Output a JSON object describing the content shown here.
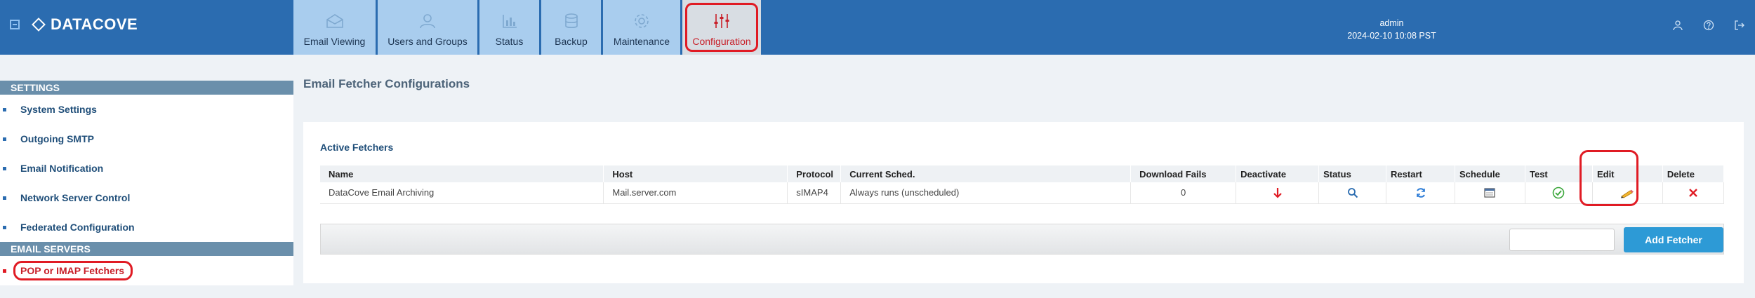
{
  "header": {
    "brand": "DATACOVE",
    "user": "admin",
    "datetime": "2024-02-10 10:08 PST",
    "accent": "#2b6cb0"
  },
  "nav": {
    "tabs": [
      {
        "label": "Email Viewing",
        "icon": "envelope-icon"
      },
      {
        "label": "Users and Groups",
        "icon": "users-icon"
      },
      {
        "label": "Status",
        "icon": "bar-chart-icon"
      },
      {
        "label": "Backup",
        "icon": "database-icon"
      },
      {
        "label": "Maintenance",
        "icon": "gear-icon"
      },
      {
        "label": "Configuration",
        "icon": "sliders-icon",
        "active": true
      }
    ]
  },
  "sidebar": {
    "settings_header": "SETTINGS",
    "settings_items": [
      {
        "label": "System Settings"
      },
      {
        "label": "Outgoing SMTP"
      },
      {
        "label": "Email Notification"
      },
      {
        "label": "Network Server Control"
      },
      {
        "label": "Federated Configuration"
      }
    ],
    "email_servers_header": "EMAIL SERVERS",
    "email_servers_items": [
      {
        "label": "POP or IMAP Fetchers",
        "active": true
      }
    ]
  },
  "main": {
    "page_title": "Email Fetcher Configurations",
    "panel_title": "Active Fetchers",
    "columns": [
      "Name",
      "Host",
      "Protocol",
      "Current Sched.",
      "Download Fails",
      "Deactivate",
      "Status",
      "Restart",
      "Schedule",
      "Test",
      "Edit",
      "Delete"
    ],
    "rows": [
      {
        "name": "DataCove Email Archiving",
        "host": "Mail.server.com",
        "protocol": "sIMAP4",
        "schedule": "Always runs (unscheduled)",
        "download_fails": "0"
      }
    ],
    "add_button": "Add Fetcher"
  }
}
